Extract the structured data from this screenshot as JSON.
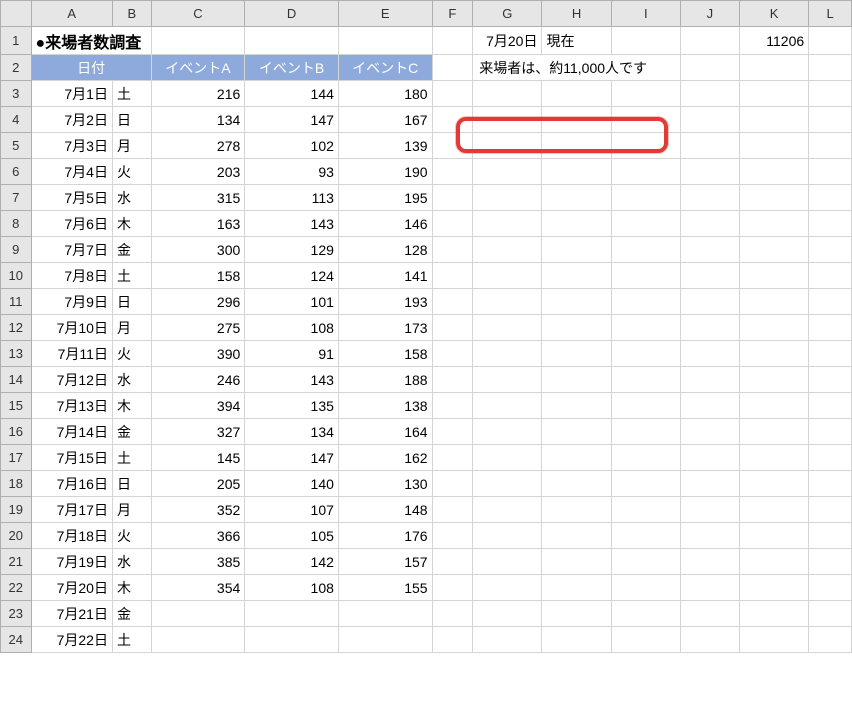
{
  "columnLetters": [
    "A",
    "B",
    "C",
    "D",
    "E",
    "F",
    "G",
    "H",
    "I",
    "J",
    "K",
    "L"
  ],
  "rowNumbers": [
    "1",
    "2",
    "3",
    "4",
    "5",
    "6",
    "7",
    "8",
    "9",
    "10",
    "11",
    "12",
    "13",
    "14",
    "15",
    "16",
    "17",
    "18",
    "19",
    "20",
    "21",
    "22",
    "23",
    "24"
  ],
  "title": "●来場者数調査",
  "g1": "7月20日",
  "h1": "現在",
  "k1": "11206",
  "headers": {
    "date": "日付",
    "eventA": "イベントA",
    "eventB": "イベントB",
    "eventC": "イベントC"
  },
  "callout": "来場者は、約11,000人です",
  "rows": [
    {
      "date": "7月1日",
      "day": "土",
      "a": "216",
      "b": "144",
      "c": "180"
    },
    {
      "date": "7月2日",
      "day": "日",
      "a": "134",
      "b": "147",
      "c": "167"
    },
    {
      "date": "7月3日",
      "day": "月",
      "a": "278",
      "b": "102",
      "c": "139"
    },
    {
      "date": "7月4日",
      "day": "火",
      "a": "203",
      "b": "93",
      "c": "190"
    },
    {
      "date": "7月5日",
      "day": "水",
      "a": "315",
      "b": "113",
      "c": "195"
    },
    {
      "date": "7月6日",
      "day": "木",
      "a": "163",
      "b": "143",
      "c": "146"
    },
    {
      "date": "7月7日",
      "day": "金",
      "a": "300",
      "b": "129",
      "c": "128"
    },
    {
      "date": "7月8日",
      "day": "土",
      "a": "158",
      "b": "124",
      "c": "141"
    },
    {
      "date": "7月9日",
      "day": "日",
      "a": "296",
      "b": "101",
      "c": "193"
    },
    {
      "date": "7月10日",
      "day": "月",
      "a": "275",
      "b": "108",
      "c": "173"
    },
    {
      "date": "7月11日",
      "day": "火",
      "a": "390",
      "b": "91",
      "c": "158"
    },
    {
      "date": "7月12日",
      "day": "水",
      "a": "246",
      "b": "143",
      "c": "188"
    },
    {
      "date": "7月13日",
      "day": "木",
      "a": "394",
      "b": "135",
      "c": "138"
    },
    {
      "date": "7月14日",
      "day": "金",
      "a": "327",
      "b": "134",
      "c": "164"
    },
    {
      "date": "7月15日",
      "day": "土",
      "a": "145",
      "b": "147",
      "c": "162"
    },
    {
      "date": "7月16日",
      "day": "日",
      "a": "205",
      "b": "140",
      "c": "130"
    },
    {
      "date": "7月17日",
      "day": "月",
      "a": "352",
      "b": "107",
      "c": "148"
    },
    {
      "date": "7月18日",
      "day": "火",
      "a": "366",
      "b": "105",
      "c": "176"
    },
    {
      "date": "7月19日",
      "day": "水",
      "a": "385",
      "b": "142",
      "c": "157"
    },
    {
      "date": "7月20日",
      "day": "木",
      "a": "354",
      "b": "108",
      "c": "155"
    },
    {
      "date": "7月21日",
      "day": "金",
      "a": "",
      "b": "",
      "c": ""
    },
    {
      "date": "7月22日",
      "day": "土",
      "a": "",
      "b": "",
      "c": ""
    }
  ],
  "chart_data": {
    "type": "table",
    "title": "来場者数調査",
    "categories": [
      "7月1日",
      "7月2日",
      "7月3日",
      "7月4日",
      "7月5日",
      "7月6日",
      "7月7日",
      "7月8日",
      "7月9日",
      "7月10日",
      "7月11日",
      "7月12日",
      "7月13日",
      "7月14日",
      "7月15日",
      "7月16日",
      "7月17日",
      "7月18日",
      "7月19日",
      "7月20日"
    ],
    "series": [
      {
        "name": "イベントA",
        "values": [
          216,
          134,
          278,
          203,
          315,
          163,
          300,
          158,
          296,
          275,
          390,
          246,
          394,
          327,
          145,
          205,
          352,
          366,
          385,
          354
        ]
      },
      {
        "name": "イベントB",
        "values": [
          144,
          147,
          102,
          93,
          113,
          143,
          129,
          124,
          101,
          108,
          91,
          143,
          135,
          134,
          147,
          140,
          107,
          105,
          142,
          108
        ]
      },
      {
        "name": "イベントC",
        "values": [
          180,
          167,
          139,
          190,
          195,
          146,
          128,
          141,
          193,
          173,
          158,
          188,
          138,
          164,
          162,
          130,
          148,
          176,
          157,
          155
        ]
      }
    ],
    "summary": {
      "date": "7月20日",
      "label": "現在",
      "total": 11206,
      "rounded_text": "来場者は、約11,000人です"
    }
  }
}
